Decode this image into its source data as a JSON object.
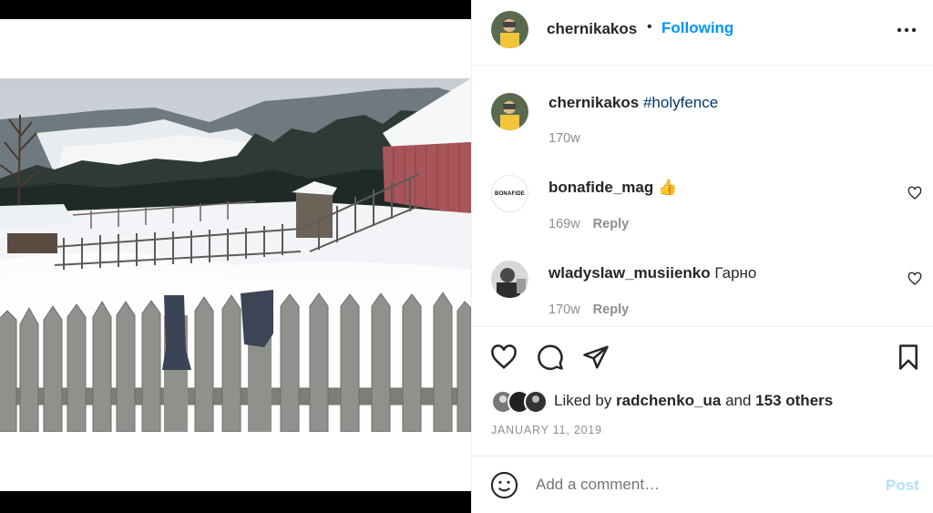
{
  "post": {
    "author": "chernikakos",
    "follow_state": "Following",
    "date": "JANUARY 11, 2019"
  },
  "caption": {
    "author": "chernikakos",
    "hashtag": "#holyfence",
    "age": "170w"
  },
  "comments": [
    {
      "author": "bonafide_mag",
      "text": "👍",
      "age": "169w",
      "reply_label": "Reply",
      "avatar_text": "BONAFIDE"
    },
    {
      "author": "wladyslaw_musiienko",
      "text": "Гарно",
      "age": "170w",
      "reply_label": "Reply"
    }
  ],
  "likes": {
    "prefix": "Liked by",
    "user": "radchenko_ua",
    "conjunction": "and",
    "others": "153 others"
  },
  "add_comment": {
    "placeholder": "Add a comment…",
    "post_label": "Post"
  },
  "colors": {
    "accent": "#0095f6",
    "post_disabled": "#b2dffc",
    "hashtag": "#00376b",
    "muted": "#8e8e8e"
  },
  "icons": [
    "more-icon",
    "heart-icon",
    "comment-icon",
    "share-icon",
    "bookmark-icon",
    "emoji-icon"
  ]
}
